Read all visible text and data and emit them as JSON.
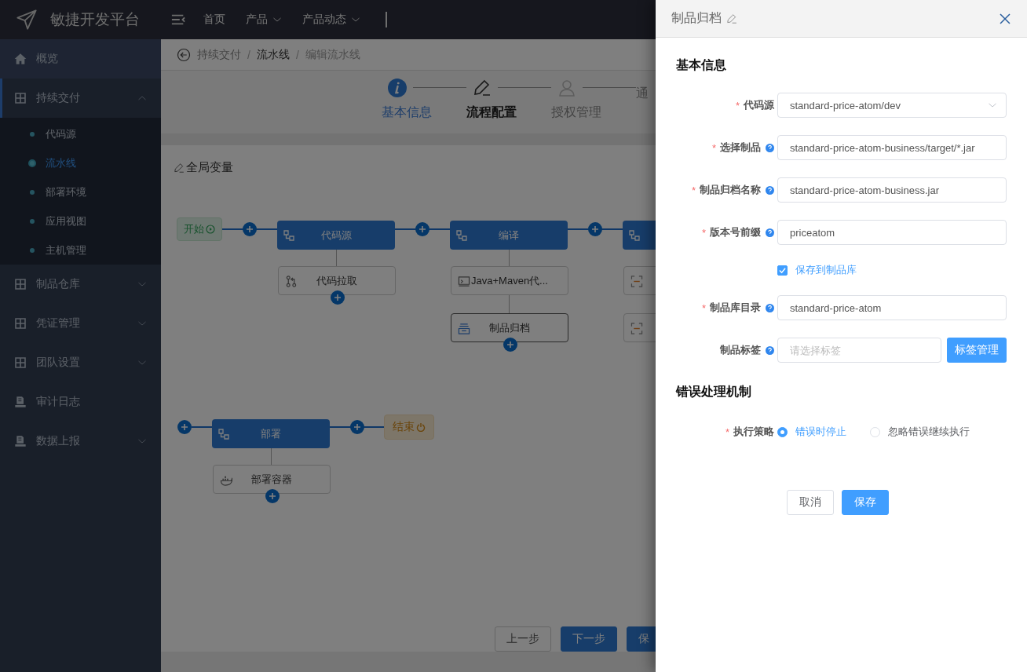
{
  "header": {
    "title": "敏捷开发平台",
    "nav": [
      {
        "label": "首页",
        "dropdown": false
      },
      {
        "label": "产品",
        "dropdown": true
      },
      {
        "label": "产品动态",
        "dropdown": true
      }
    ]
  },
  "sidebar": {
    "items": [
      {
        "label": "概览",
        "expandable": false,
        "highlighted": true
      },
      {
        "label": "持续交付",
        "expandable": true,
        "expanded": true,
        "highlighted": false,
        "children": [
          {
            "label": "代码源",
            "selected": false
          },
          {
            "label": "流水线",
            "selected": true
          },
          {
            "label": "部署环境",
            "selected": false
          },
          {
            "label": "应用视图",
            "selected": false
          },
          {
            "label": "主机管理",
            "selected": false
          }
        ]
      },
      {
        "label": "制品仓库",
        "expandable": true,
        "expanded": false,
        "highlighted": false
      },
      {
        "label": "凭证管理",
        "expandable": true,
        "expanded": false,
        "highlighted": false
      },
      {
        "label": "团队设置",
        "expandable": true,
        "expanded": false,
        "highlighted": false
      },
      {
        "label": "审计日志",
        "expandable": false,
        "highlighted": false
      },
      {
        "label": "数据上报",
        "expandable": true,
        "expanded": false,
        "highlighted": false
      }
    ]
  },
  "breadcrumb": [
    {
      "kind": "link",
      "label": "持续交付"
    },
    {
      "kind": "separator",
      "label": "/"
    },
    {
      "kind": "link",
      "label": "流水线"
    },
    {
      "kind": "separator",
      "label": "/"
    },
    {
      "kind": "current",
      "label": "编辑流水线"
    }
  ],
  "steps": [
    {
      "label": "基本信息",
      "done": true,
      "selected": false
    },
    {
      "label": "流程配置",
      "done": false,
      "selected": true
    },
    {
      "label": "授权管理",
      "done": false,
      "selected": false
    },
    {
      "label": "通",
      "done": false,
      "selected": false
    }
  ],
  "pipeline": {
    "title": "全局变量",
    "start": {
      "label": "开始"
    },
    "end": {
      "label": "结束"
    },
    "stages": [
      {
        "label": "代码源",
        "tasks": [
          {
            "label": "代码拉取",
            "kind": "branch",
            "selected": false
          }
        ]
      },
      {
        "label": "编译",
        "tasks": [
          {
            "label": "Java+Maven代...",
            "kind": "terminal",
            "selected": false
          },
          {
            "label": "制品归档",
            "kind": "archive",
            "selected": true
          }
        ]
      },
      {
        "tasks": [
          {
            "kind": "scan",
            "selected": false
          },
          {
            "kind": "scan",
            "selected": false
          }
        ]
      },
      {
        "label": "部署",
        "tasks": [
          {
            "label": "部署容器",
            "kind": "docker",
            "selected": false
          }
        ]
      }
    ]
  },
  "page_buttons": [
    {
      "label": "上一步",
      "primary": false
    },
    {
      "label": "下一步",
      "primary": true
    },
    {
      "label": "保",
      "primary": true
    }
  ],
  "drawer": {
    "title": "制品归档",
    "sections": [
      {
        "title": "基本信息",
        "fields": [
          {
            "kind": "select",
            "label": "代码源",
            "required_mark": "*",
            "help": false,
            "value": "standard-price-atom/dev"
          },
          {
            "kind": "input",
            "label": "选择制品",
            "required_mark": "*",
            "help": true,
            "value": "standard-price-atom-business/target/*.jar"
          },
          {
            "kind": "input",
            "label": "制品归档名称",
            "required_mark": "*",
            "help": true,
            "value": "standard-price-atom-business.jar"
          },
          {
            "kind": "input",
            "label": "版本号前缀",
            "required_mark": "*",
            "help": true,
            "value": "priceatom"
          },
          {
            "kind": "checkbox",
            "label": "保存到制品库",
            "checked": true
          },
          {
            "kind": "input",
            "label": "制品库目录",
            "required_mark": "*",
            "help": true,
            "value": "standard-price-atom"
          },
          {
            "kind": "tags",
            "label": "制品标签",
            "help": true,
            "placeholder": "请选择标签",
            "button": "标签管理"
          }
        ]
      },
      {
        "title": "错误处理机制",
        "fields": [
          {
            "kind": "radio",
            "label": "执行策略",
            "required_mark": "*",
            "help": false,
            "options": [
              {
                "label": "错误时停止",
                "selected": true
              },
              {
                "label": "忽略错误继续执行",
                "selected": false
              }
            ]
          }
        ]
      }
    ],
    "buttons": [
      {
        "label": "取消",
        "primary": false
      },
      {
        "label": "保存",
        "primary": true
      }
    ]
  }
}
